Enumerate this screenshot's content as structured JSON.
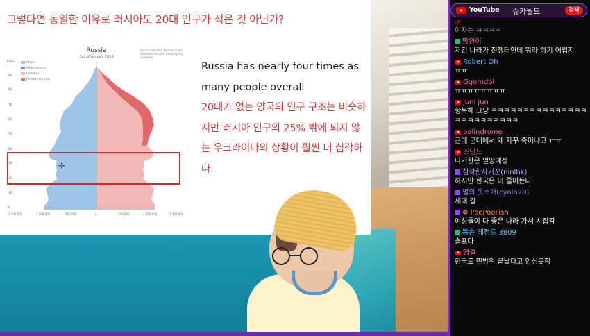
{
  "slide": {
    "title": "그렇다면 동일한 이유로 러시아도 20대 인구가 적은 것 아닌가?",
    "chart": {
      "title": "Russia",
      "subtitle": "1st of January 2024",
      "source": "Source: Rosstat, Federal State Statistics Service; Chart by Ivy Gallaway",
      "legend": [
        "Males",
        "Male surplus",
        "Females",
        "Female surplus"
      ],
      "x_ticks": [
        "1,500,000",
        "1,000,000",
        "500,000",
        "0",
        "500,000",
        "1,000,000",
        "1,500,000"
      ],
      "y_ticks": [
        "100+",
        "90",
        "80",
        "70",
        "60",
        "50",
        "40",
        "30",
        "20",
        "10",
        "0"
      ],
      "colors": {
        "male": "#9ec5e8",
        "female": "#f2b7b7",
        "female_surplus": "#e06a6a"
      }
    },
    "text_en": "Russia has nearly four times as many people overall",
    "text_ko": "20대가 없는 양국의 인구 구조는 비슷하지만 러시아 인구의 25% 밖에 되지 않는 우크라이나의 상황이 훨씬 더 심각하다."
  },
  "chat": {
    "header": {
      "platform": "YouTube",
      "channel": "슈카월드",
      "search_label": "검색"
    },
    "messages": [
      {
        "platform": "yt",
        "name": "",
        "name_color": "gray",
        "text": "이자는 ㅋㅋㅋㅋ"
      },
      {
        "platform": "sq",
        "name": "망원이",
        "name_color": "pink",
        "text": "저긴 나라가 전쟁터인데 뭐라 하기 어렵지"
      },
      {
        "platform": "yt",
        "name": "Robert Oh",
        "name_color": "blue",
        "text": "ㅠㅠ"
      },
      {
        "platform": "yt",
        "name": "Ggomdol",
        "name_color": "pink",
        "text": "ㅠㅠㅠㅠㅠㅠㅠㅠ"
      },
      {
        "platform": "yt",
        "name": "juni jun",
        "name_color": "pink",
        "text": "항복해 그냥 ㅋㅋㅋㅋㅋㅋㅋㅋㅋㅋㅋㅋㅋㅋㅋㅋㅋㅋㅋㅋㅋㅋㅋㅋㅋ"
      },
      {
        "platform": "yt",
        "name": "palindrome",
        "name_color": "pink",
        "text": "근데 군대에서 왜 자꾸 죽이냐고 ㅠㅠ"
      },
      {
        "platform": "yt",
        "name": "조닌느",
        "name_color": "pink",
        "text": "나거한은 멸망예정"
      },
      {
        "platform": "tw",
        "name": "침착한사기꾼(ninlhk)",
        "name_color": "lightpurple",
        "text": "하지만 한국은 더 줄어든다"
      },
      {
        "platform": "tw",
        "name": "별의 옷소매(cyolb20)",
        "name_color": "purple",
        "text": "세대 갈"
      },
      {
        "platform": "tw",
        "name": "❁ PooPooFish",
        "name_color": "orange",
        "text": "여성들이 다 좋은 나라 가서 시집감"
      },
      {
        "platform": "sq",
        "name": "똥손 레전드 3809",
        "name_color": "cyan",
        "text": "슬프다"
      },
      {
        "platform": "yt",
        "name": "영걸",
        "name_color": "pink",
        "text": "한국도 민방위 끝났다고 안심못함"
      }
    ]
  }
}
